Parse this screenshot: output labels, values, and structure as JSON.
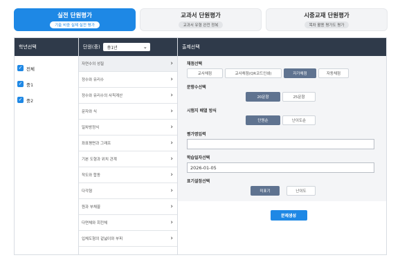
{
  "tabs": [
    {
      "title": "실전 단원평가",
      "subtitle": "기출 비중 실제 실전 평가",
      "active": true
    },
    {
      "title": "교과서 단원평가",
      "subtitle": "교과서 유형 완전 정복",
      "active": false
    },
    {
      "title": "시중교재 단원평가",
      "subtitle": "목차 활용 평가도 평가",
      "active": false
    }
  ],
  "grade": {
    "header": "학년선택",
    "items": [
      {
        "label": "전체",
        "checked": true
      },
      {
        "label": "중1",
        "checked": true
      },
      {
        "label": "중2",
        "checked": true
      }
    ]
  },
  "unit": {
    "header": "단원(중)",
    "select_value": "중1년",
    "items": [
      "자연수의 성질",
      "정수와 유리수",
      "정수와 유리수의 사칙계산",
      "문자와 식",
      "일차방정식",
      "좌표평면과 그래프",
      "기본 도형과 위치 관계",
      "작도와 합동",
      "다각형",
      "원과 부채꼴",
      "다면체와 회전체",
      "입체도형의 겉넓이와 부피"
    ]
  },
  "options": {
    "header": "출제선택",
    "type": {
      "label": "채점선택",
      "buttons": [
        "교사채점",
        "교사채점(QR코드인쇄)",
        "자가채점",
        "자동채점"
      ],
      "selected": 2
    },
    "count": {
      "label": "문항수선택",
      "buttons": [
        "20문항",
        "25문항"
      ],
      "selected": 0
    },
    "layout": {
      "label": "시험지 배열 방식",
      "buttons": [
        "단원순",
        "난이도순"
      ],
      "selected": 0
    },
    "name": {
      "label": "평가명입력",
      "value": ""
    },
    "date": {
      "label": "학습일자선택",
      "value": "2026-01-05"
    },
    "show": {
      "label": "표기설정선택",
      "buttons": [
        "미표기",
        "난이도"
      ],
      "selected": 0
    },
    "submit_label": "문제생성"
  },
  "colors": {
    "accent": "#1e88e5",
    "header": "#2f3a4a",
    "selected_button": "#5f7390"
  }
}
